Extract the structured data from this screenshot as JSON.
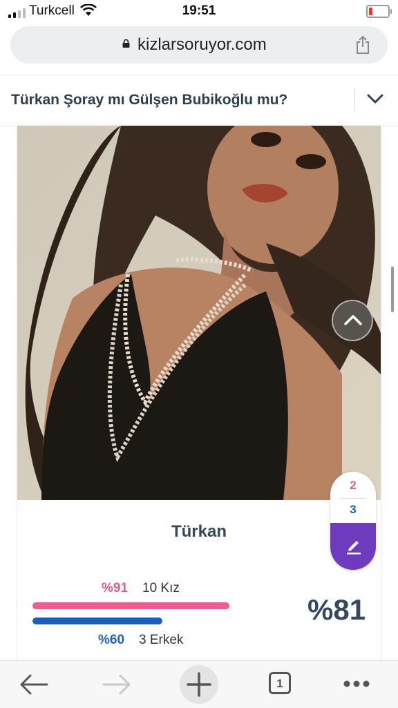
{
  "status_bar": {
    "carrier": "Turkcell",
    "time": "19:51"
  },
  "browser": {
    "url": "kizlarsoruyor.com"
  },
  "question": {
    "title": "Türkan Şoray mı Gülşen Bubikoğlu mu?"
  },
  "option": {
    "name": "Türkan",
    "female": {
      "percent_label": "%91",
      "count_label": "10 Kız",
      "bar_fraction": 0.91
    },
    "male": {
      "percent_label": "%60",
      "count_label": "3 Erkek",
      "bar_fraction": 0.6
    },
    "total_label": "%81"
  },
  "floating": {
    "female_count": "2",
    "male_count": "3"
  },
  "toolbar": {
    "tab_count": "1"
  },
  "colors": {
    "female": "#f25a91",
    "male": "#1d5fbf",
    "accent": "#6e3bbf",
    "text": "#34495e"
  },
  "icons": [
    "signal-icon",
    "wifi-icon",
    "battery-icon",
    "lock-icon",
    "share-icon",
    "chevron-down-icon",
    "chevron-up-icon",
    "edit-icon",
    "back-arrow-icon",
    "forward-arrow-icon",
    "plus-icon",
    "tabs-icon",
    "more-icon"
  ]
}
